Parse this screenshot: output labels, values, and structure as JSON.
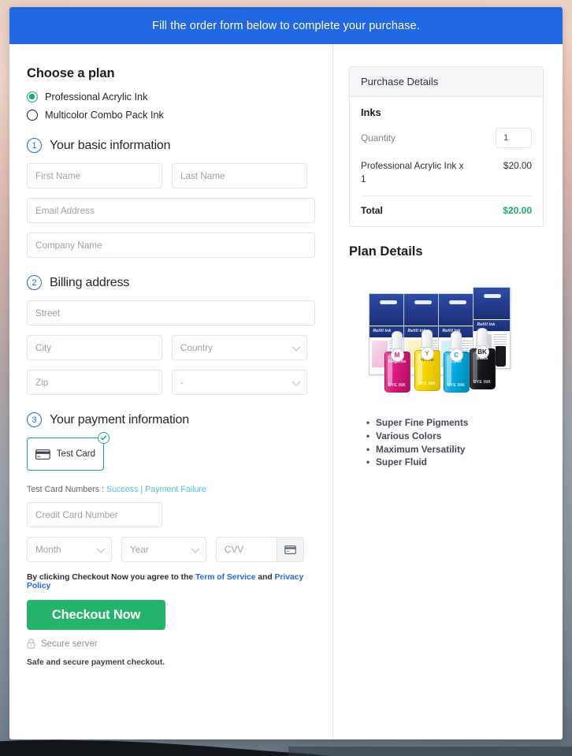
{
  "banner": {
    "text": "Fill the order form below to complete your purchase."
  },
  "plan": {
    "heading": "Choose a plan",
    "options": [
      {
        "label": "Professional Acrylic Ink",
        "selected": true
      },
      {
        "label": "Multicolor Combo Pack Ink",
        "selected": false
      }
    ]
  },
  "steps": {
    "basic": {
      "num": "1",
      "title": "Your basic information"
    },
    "billing": {
      "num": "2",
      "title": "Billing address"
    },
    "payment": {
      "num": "3",
      "title": "Your payment information"
    }
  },
  "basic_fields": {
    "first_name": {
      "value": "",
      "placeholder": "First Name"
    },
    "last_name": {
      "value": "",
      "placeholder": "Last Name"
    },
    "email": {
      "value": "",
      "placeholder": "Email Address"
    },
    "company": {
      "value": "",
      "placeholder": "Company Name"
    }
  },
  "billing_fields": {
    "street": {
      "value": "",
      "placeholder": "Street"
    },
    "city": {
      "value": "",
      "placeholder": "City"
    },
    "country": {
      "value": "",
      "placeholder": "Country"
    },
    "zip": {
      "value": "",
      "placeholder": "Zip"
    },
    "state": {
      "value": "",
      "placeholder": "-"
    }
  },
  "payment": {
    "method_label": "Test Card",
    "test_numbers_prefix": "Test Card Numbers : ",
    "test_success": "Success",
    "test_separator": " | ",
    "test_failure": "Payment Failure",
    "card_number": {
      "value": "",
      "placeholder": "Credit Card Number"
    },
    "month": {
      "value": "",
      "placeholder": "Month"
    },
    "year": {
      "value": "",
      "placeholder": "Year"
    },
    "cvv": {
      "value": "",
      "placeholder": "CVV"
    }
  },
  "footer": {
    "legal_prefix": "By clicking Checkout Now you agree to the ",
    "terms_link": "Term of Service",
    "legal_and": " and ",
    "privacy_link": "Privacy Policy",
    "checkout_button": "Checkout Now",
    "secure_server": "Secure server",
    "safe_note": "Safe and secure payment checkout."
  },
  "purchase": {
    "header": "Purchase Details",
    "group_title": "Inks",
    "quantity_label": "Quantity",
    "quantity_value": "1",
    "line_item_name": "Professional Acrylic Ink x 1",
    "line_item_price": "$20.00",
    "total_label": "Total",
    "total_value": "$20.00"
  },
  "plan_details": {
    "title": "Plan Details",
    "image_alt": "refill-ink-bottles-product-photo",
    "bullets": [
      "Super Fine Pigments",
      "Various Colors",
      "Maximum Versatility",
      "Super Fluid"
    ],
    "ink_colors": [
      {
        "name": "Magenta",
        "code": "M",
        "hex": "#d9197e"
      },
      {
        "name": "Yellow",
        "code": "Y",
        "hex": "#f5d300"
      },
      {
        "name": "Cyan",
        "code": "C",
        "hex": "#00a9e0"
      },
      {
        "name": "Black",
        "code": "BK",
        "hex": "#16181c"
      }
    ],
    "box_label": "Refill Ink",
    "dye_label": "DYE INK"
  },
  "colors": {
    "banner_blue": "#2268e3",
    "accent_green": "#16a97a",
    "button_green": "#24b36b",
    "total_green": "#18ad62",
    "link_blue": "#2268e3",
    "link_teal": "#4ec3d4"
  }
}
